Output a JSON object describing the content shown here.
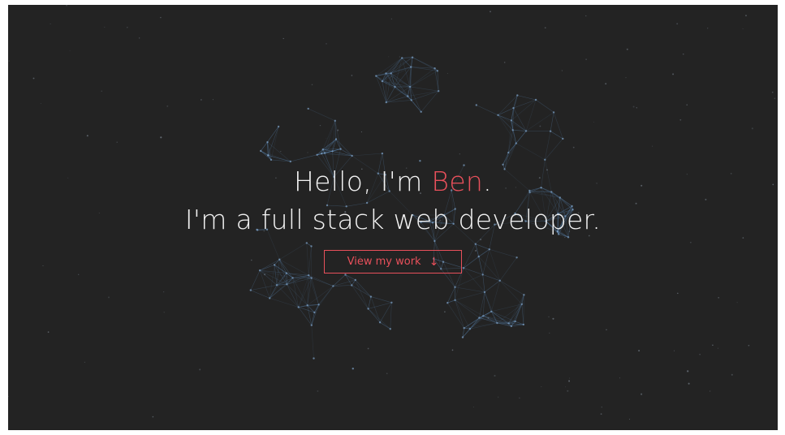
{
  "hero": {
    "greeting_prefix": "Hello, I'm ",
    "name": "Ben",
    "greeting_suffix": ".",
    "tagline": "I'm a full stack web developer."
  },
  "cta": {
    "label": "View my work",
    "icon": "arrow-down-icon"
  },
  "colors": {
    "background": "#232323",
    "accent": "#e8505b",
    "network": "#5a86b3",
    "text": "#f2f2f2"
  }
}
